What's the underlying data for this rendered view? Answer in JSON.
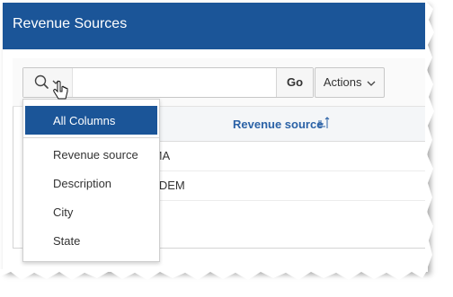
{
  "header": {
    "title": "Revenue Sources"
  },
  "toolbar": {
    "search": {
      "value": "",
      "placeholder": ""
    },
    "go_label": "Go",
    "actions_label": "Actions"
  },
  "table": {
    "column_header": "Revenue source",
    "rows": [
      {
        "revenue_source": "FEMA"
      },
      {
        "revenue_source": "OR-DEM"
      }
    ]
  },
  "menu": {
    "selected": "All Columns",
    "items": [
      "Revenue source",
      "Description",
      "City",
      "State"
    ]
  },
  "colors": {
    "accent": "#1b5598",
    "link": "#2b62a6"
  },
  "icons": {
    "search": "search-icon",
    "chevron": "chevron-down-icon",
    "sort": "sort-ascending-icon",
    "cursor": "hand-pointer-cursor-icon"
  }
}
